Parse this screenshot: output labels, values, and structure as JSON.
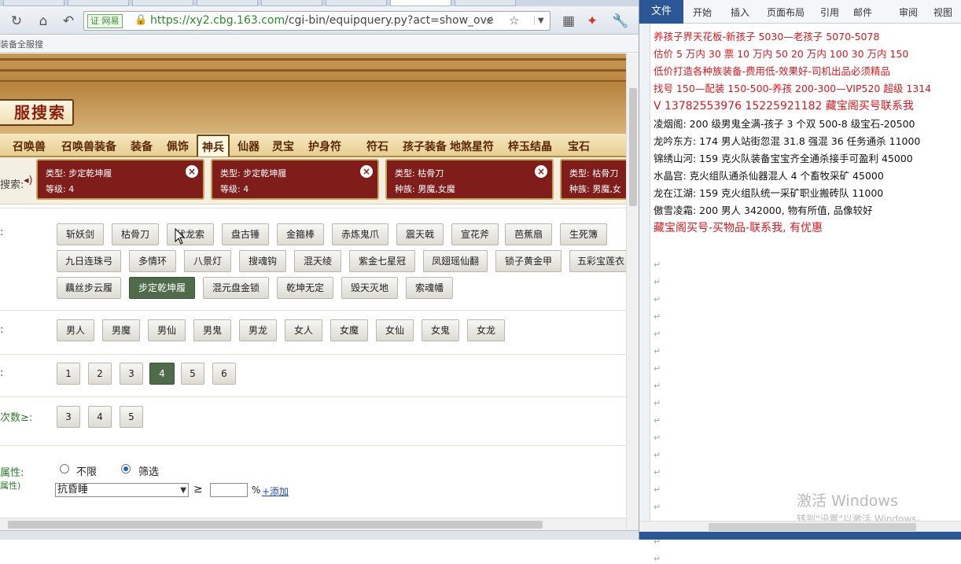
{
  "browser": {
    "url_badge": "证 网易",
    "url_domain": "https://xy2.cbg.163.com",
    "url_path": "/cgi-bin/equipquery.py?act=show_ove",
    "bookmark": "装备全服搜"
  },
  "site": {
    "title": "服搜索",
    "categories": [
      "召唤兽",
      "召唤兽装备",
      "装备",
      "佩饰",
      "神兵",
      "仙器",
      "灵宝",
      "护身符",
      "符石",
      "孩子装备",
      "地煞星符",
      "梓玉结晶",
      "宝石"
    ],
    "active_category": "神兵",
    "chip_row_label": "搜索:",
    "chips": [
      {
        "line1": "类型: 步定乾坤履",
        "line2": "等级: 4"
      },
      {
        "line1": "类型: 步定乾坤履",
        "line2": "等级: 4"
      },
      {
        "line1": "类型: 枯骨刀",
        "line2": "种族: 男魔,女魔"
      },
      {
        "line1": "类型: 枯骨刀",
        "line2": "种族: 男魔,女"
      }
    ],
    "type_label": ":",
    "types_row1": [
      "斩妖剑",
      "枯骨刀",
      "伏龙索",
      "盘古锤",
      "金箍棒",
      "赤炼鬼爪",
      "震天戟",
      "宣花斧",
      "芭蕉扇",
      "生死簿"
    ],
    "types_row2": [
      "九日连珠弓",
      "多情环",
      "八景灯",
      "搜魂钩",
      "混天绫",
      "紫金七星冠",
      "凤翅瑶仙翻",
      "锁子黄金甲",
      "五彩宝莲衣"
    ],
    "types_row3": [
      "藕丝步云履",
      "步定乾坤履",
      "混元盘金锁",
      "乾坤无定",
      "毁天灭地",
      "索魂幡"
    ],
    "selected_type": "步定乾坤履",
    "race_label": ":",
    "races": [
      "男人",
      "男魔",
      "男仙",
      "男鬼",
      "男龙",
      "女人",
      "女魔",
      "女仙",
      "女鬼",
      "女龙"
    ],
    "level_label": ":",
    "levels": [
      "1",
      "2",
      "3",
      "4",
      "5",
      "6"
    ],
    "selected_level": "4",
    "times_label": "次数≥:",
    "times": [
      "3",
      "4",
      "5"
    ],
    "attr_label": "属性:",
    "attr_sublabel": "属性)",
    "radio_any": "不限",
    "radio_filter": "筛选",
    "attr_select": "抗昏睡",
    "ge": "≥",
    "percent": "%",
    "add_link": "+添加"
  },
  "word": {
    "file_tab": "文件",
    "tabs": [
      "开始",
      "插入",
      "页面布局",
      "引用",
      "邮件",
      "审阅",
      "视图"
    ],
    "lines": [
      {
        "text": "养孩子界天花板-新孩子 5030—老孩子 5070-5078",
        "red": true
      },
      {
        "text": "估价 5 万内 30 票  10 万内 50  20 万内 100  30 万内 150",
        "red": true
      },
      {
        "text": "低价打造各种族装备-费用低-效果好-司机出品必须精品",
        "red": true
      },
      {
        "text": "找号 150—配装 150-500-养孩 200-300—VIP520 超级 1314",
        "red": true
      },
      {
        "text": "V 13782553976   15225921182  藏宝阁买号联系我",
        "red": true,
        "big": true
      },
      {
        "text": "凌烟阁: 200 级男鬼全满-孩子 3 个双 500-8 级宝石-20500",
        "red": false
      },
      {
        "text": "龙吟东方: 174 男人站街忽混 31.8 强混 36 任务通杀 11000",
        "red": false
      },
      {
        "text": "锦绣山河: 159 克火队装备宝宝齐全通杀接手可盈利 45000",
        "red": false
      },
      {
        "text": "水晶宫: 克火组队通杀仙器混人 4 个畜牧采矿 45000",
        "red": false
      },
      {
        "text": "龙在江湖: 159 克火组队统一采矿职业搬砖队 11000",
        "red": false
      },
      {
        "text": "傲雪凌霜: 200 男人 342000, 物有所值, 品像较好",
        "red": false
      },
      {
        "text": "藏宝阁买号-买物品-联系我, 有优惠",
        "red": true,
        "big": true
      }
    ],
    "watermark_title": "激活 Windows",
    "watermark_sub": "转到\"设置\"以激活 Windows。"
  }
}
